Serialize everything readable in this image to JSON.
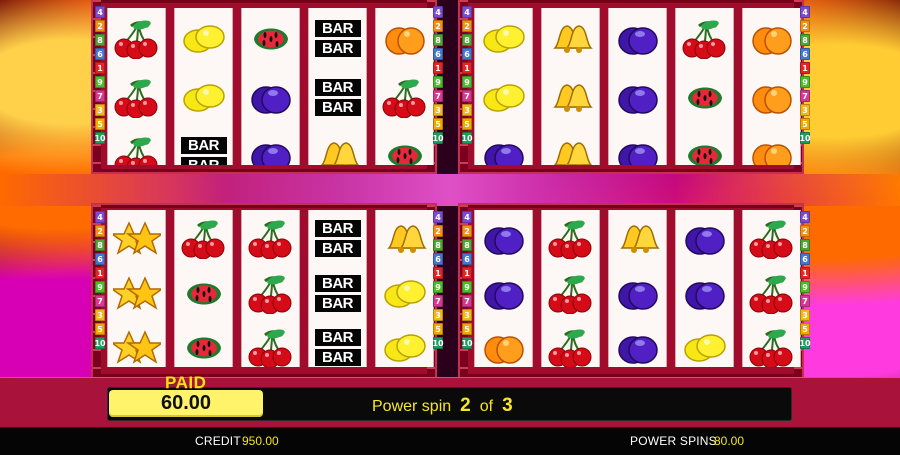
{
  "game": {
    "paid_label": "PAID",
    "paid_amount": "60.00",
    "power_spin_label": "Power spin",
    "power_spin_current": "2",
    "power_spin_separator": "of",
    "power_spin_total": "3",
    "credit_label": "CREDIT",
    "credit_value": "950.00",
    "power_spins_label": "POWER SPINS",
    "power_spins_value": "80.00"
  },
  "symbols": {
    "bar": "BAR",
    "cherry": "cherries",
    "lemon": "lemons",
    "watermelon": "watermelon",
    "plum": "plums",
    "orange": "oranges",
    "bell": "bells",
    "star": "stars"
  },
  "grids": [
    {
      "name": "top-left",
      "reels": [
        [
          "cherry",
          "cherry",
          "cherry"
        ],
        [
          "lemon",
          "lemon",
          "bar"
        ],
        [
          "watermelon",
          "plum",
          "plum"
        ],
        [
          "bar",
          "bar",
          "bell"
        ],
        [
          "orange",
          "cherry",
          "watermelon"
        ]
      ]
    },
    {
      "name": "top-right",
      "reels": [
        [
          "lemon",
          "lemon",
          "plum"
        ],
        [
          "bell",
          "bell",
          "bell"
        ],
        [
          "plum",
          "plum",
          "plum"
        ],
        [
          "cherry",
          "watermelon",
          "watermelon"
        ],
        [
          "orange",
          "orange",
          "orange"
        ]
      ]
    },
    {
      "name": "bottom-left",
      "reels": [
        [
          "star",
          "star",
          "star"
        ],
        [
          "cherry",
          "watermelon",
          "watermelon"
        ],
        [
          "cherry",
          "cherry",
          "cherry"
        ],
        [
          "bar",
          "bar",
          "bar"
        ],
        [
          "bell",
          "lemon",
          "lemon"
        ]
      ]
    },
    {
      "name": "bottom-right",
      "reels": [
        [
          "plum",
          "plum",
          "orange"
        ],
        [
          "cherry",
          "cherry",
          "cherry"
        ],
        [
          "bell",
          "plum",
          "plum"
        ],
        [
          "plum",
          "plum",
          "lemon"
        ],
        [
          "cherry",
          "cherry",
          "cherry"
        ]
      ]
    }
  ],
  "payline_numbers": [
    "4",
    "2",
    "8",
    "6",
    "1",
    "9",
    "7",
    "3",
    "5",
    "10"
  ],
  "colors": {
    "accent_yellow": "#ffdf16",
    "panel_red": "#a9123a",
    "reel_bg": "#fdf8f5"
  }
}
